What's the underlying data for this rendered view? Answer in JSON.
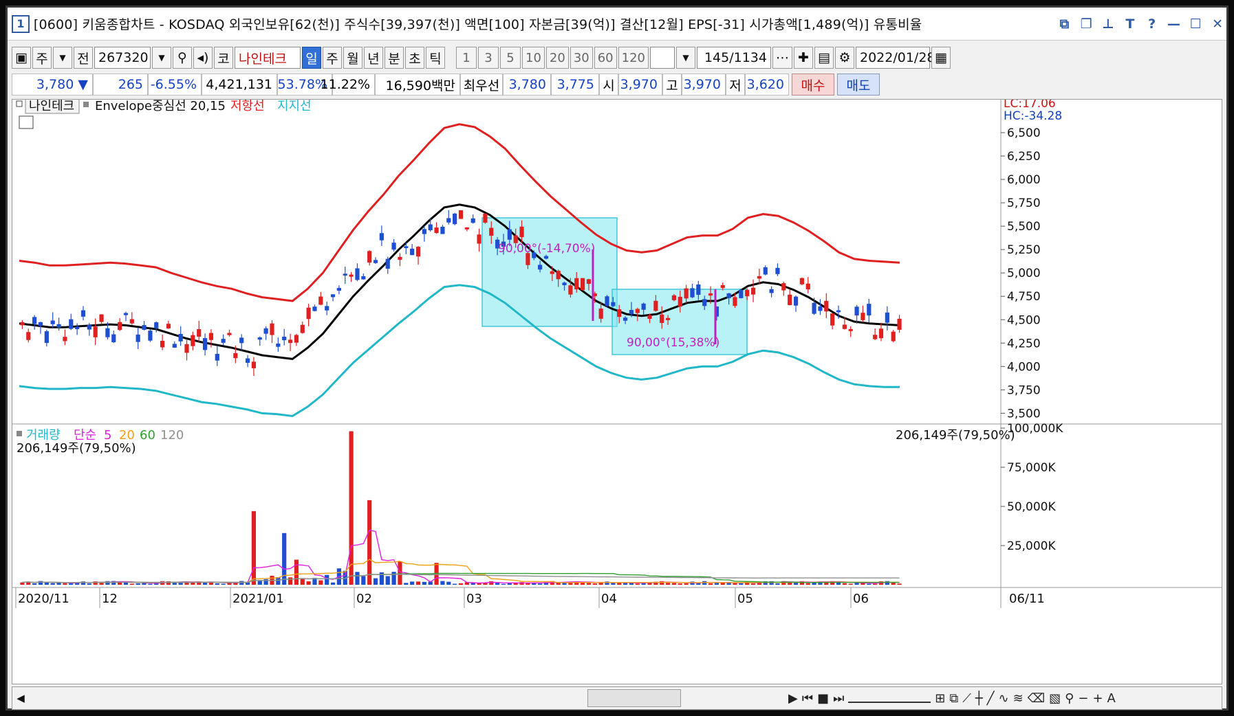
{
  "window": {
    "number": "1",
    "title": "[0600] 키움종합차트 - KOSDAQ 외국인보유[62(천)] 주식수[39,397(천)] 액면[100] 자본금[39(억)] 결산[12월] EPS[-31] 시가총액[1,489(억)] 유통비율"
  },
  "toolbar": {
    "stock_type": "주",
    "prev_label": "전",
    "code": "267320",
    "market": "코",
    "stock_name": "나인테크",
    "periods": [
      "일",
      "주",
      "월",
      "년",
      "분",
      "초",
      "틱"
    ],
    "selected_period": "일",
    "minute_options": [
      "1",
      "3",
      "5",
      "10",
      "20",
      "30",
      "60",
      "120"
    ],
    "count": "145",
    "total": "/1134",
    "date": "2022/01/28"
  },
  "quote": {
    "price": "3,780",
    "arrow": "▼",
    "change": "265",
    "change_pct": "-6.55%",
    "volume": "4,421,131",
    "vol_ratio": "53.78%",
    "turnover": "11.22%",
    "amount": "16,590백만",
    "best_label": "최우선",
    "ask": "3,780",
    "bid": "3,775",
    "open_label": "시",
    "open": "3,970",
    "high_label": "고",
    "high": "3,970",
    "low_label": "저",
    "low": "3,620",
    "buy_label": "매수",
    "sell_label": "매도"
  },
  "chart_data": [
    {
      "type": "candlestick",
      "panel": "price",
      "legend": {
        "stock": "나인테크",
        "indicator": "Envelope중심선 20,15",
        "upper": "저항선",
        "lower": "지지선"
      },
      "corner_labels": {
        "lc": "LC:17.06",
        "hc": "HC:-34.28"
      },
      "y_ticks": [
        "6,500",
        "6,250",
        "6,000",
        "5,750",
        "5,500",
        "5,250",
        "5,000",
        "4,750",
        "4,500",
        "4,250",
        "4,000",
        "3,750",
        "3,500"
      ],
      "ylim": [
        3400,
        6750
      ],
      "x_ticks": [
        "2020/11",
        "12",
        "2021/01",
        "02",
        "03",
        "04",
        "05",
        "06"
      ],
      "x_end_label": "06/11",
      "series": [
        {
          "name": "Envelope중심선",
          "color": "#000000",
          "values": [
            4460,
            4440,
            4420,
            4420,
            4430,
            4440,
            4450,
            4440,
            4420,
            4400,
            4350,
            4300,
            4260,
            4230,
            4200,
            4160,
            4120,
            4100,
            4080,
            4200,
            4350,
            4550,
            4750,
            4920,
            5080,
            5250,
            5400,
            5560,
            5700,
            5730,
            5700,
            5620,
            5500,
            5350,
            5200,
            5060,
            4940,
            4820,
            4700,
            4620,
            4560,
            4540,
            4560,
            4620,
            4680,
            4700,
            4700,
            4760,
            4860,
            4900,
            4880,
            4820,
            4740,
            4640,
            4540,
            4480,
            4460,
            4450,
            4440
          ]
        },
        {
          "name": "저항선",
          "color": "#e02020",
          "values": [
            5130,
            5110,
            5080,
            5080,
            5090,
            5100,
            5110,
            5100,
            5080,
            5060,
            5000,
            4950,
            4900,
            4860,
            4830,
            4780,
            4740,
            4720,
            4700,
            4830,
            5000,
            5230,
            5460,
            5660,
            5840,
            6040,
            6210,
            6390,
            6550,
            6590,
            6560,
            6460,
            6330,
            6150,
            5980,
            5820,
            5680,
            5540,
            5410,
            5310,
            5240,
            5220,
            5240,
            5310,
            5380,
            5400,
            5400,
            5470,
            5590,
            5630,
            5610,
            5540,
            5450,
            5340,
            5220,
            5150,
            5130,
            5120,
            5110
          ]
        },
        {
          "name": "지지선",
          "color": "#20b8c8",
          "values": [
            3790,
            3770,
            3760,
            3760,
            3770,
            3770,
            3780,
            3770,
            3760,
            3740,
            3700,
            3660,
            3620,
            3600,
            3570,
            3540,
            3500,
            3490,
            3470,
            3570,
            3700,
            3870,
            4040,
            4180,
            4320,
            4460,
            4590,
            4730,
            4850,
            4870,
            4850,
            4780,
            4680,
            4550,
            4420,
            4300,
            4200,
            4100,
            4000,
            3930,
            3880,
            3860,
            3880,
            3930,
            3980,
            4000,
            4000,
            4050,
            4130,
            4170,
            4150,
            4100,
            4030,
            3940,
            3860,
            3810,
            3790,
            3780,
            3780
          ]
        }
      ],
      "candles_note": "daily OHLC bars, red=up blue=down",
      "annotations": [
        {
          "text": "90,00°(-14,70%)",
          "color": "#c020c0"
        },
        {
          "text": "90,00°(15,38%)",
          "color": "#c020c0"
        }
      ]
    },
    {
      "type": "bar",
      "panel": "volume",
      "legend": {
        "name": "거래량",
        "ma_label": "단순",
        "ma": [
          "5",
          "20",
          "60",
          "120"
        ]
      },
      "value_label": "206,149주(79,50%)",
      "y_ticks": [
        "100,000K",
        "75,000K",
        "50,000K",
        "25,000K"
      ],
      "ylim": [
        0,
        100000
      ]
    }
  ],
  "colors": {
    "up": "#e02020",
    "down": "#1e4fd0",
    "box": "#7fe7ee",
    "accent": "#2f6fd6"
  }
}
